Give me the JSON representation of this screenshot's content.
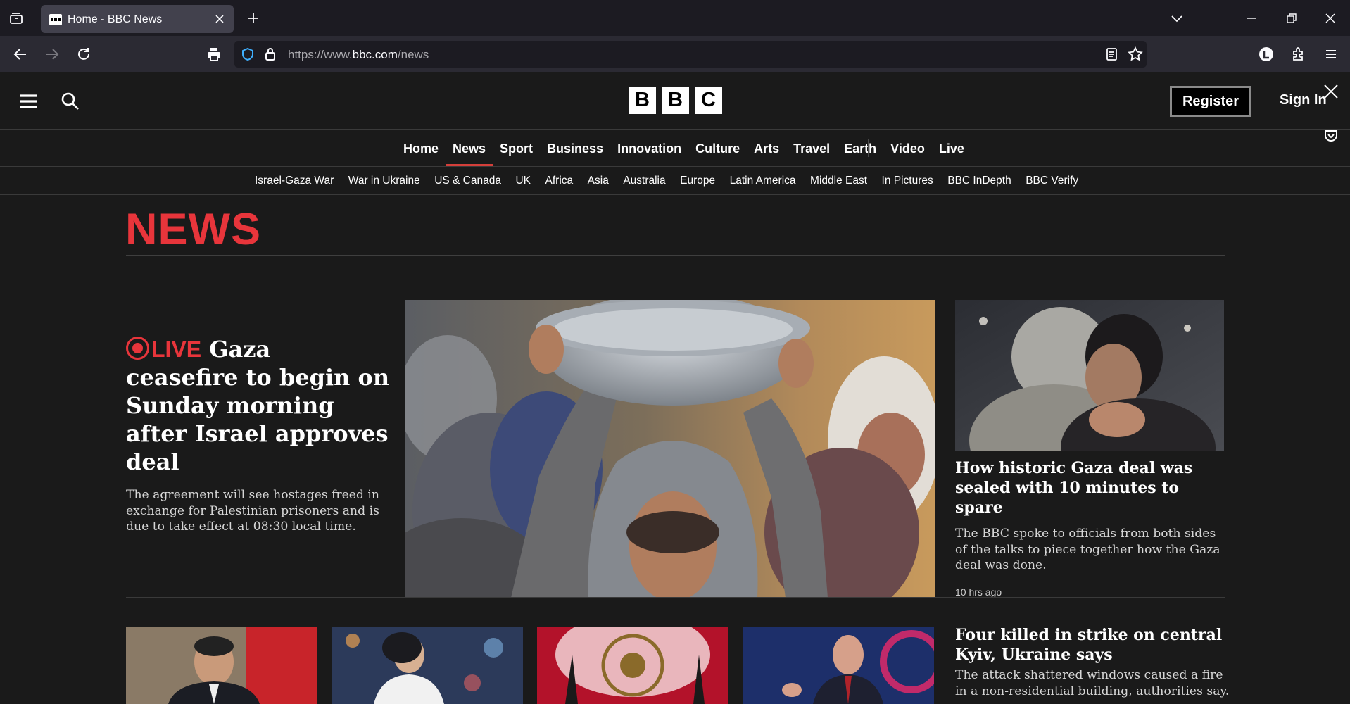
{
  "browser": {
    "tab_title": "Home - BBC News",
    "url_prefix": "https://www.",
    "url_domain": "bbc.com",
    "url_path": "/news"
  },
  "masthead": {
    "logo_letters": [
      "B",
      "B",
      "C"
    ],
    "register_label": "Register",
    "signin_label": "Sign In"
  },
  "primary_nav": [
    "Home",
    "News",
    "Sport",
    "Business",
    "Innovation",
    "Culture",
    "Arts",
    "Travel",
    "Earth",
    "Video",
    "Live"
  ],
  "primary_nav_active": "News",
  "secondary_nav": [
    "Israel-Gaza War",
    "War in Ukraine",
    "US & Canada",
    "UK",
    "Africa",
    "Asia",
    "Australia",
    "Europe",
    "Latin America",
    "Middle East",
    "In Pictures",
    "BBC InDepth",
    "BBC Verify"
  ],
  "section_title": "NEWS",
  "lead_story": {
    "live_label": "LIVE",
    "headline": "Gaza ceasefire to begin on Sunday morning after Israel approves deal",
    "summary": "The agreement will see hostages freed in exchange for Palestinian prisoners and is due to take effect at 08:30 local time."
  },
  "side_story": {
    "headline": "How historic Gaza deal was sealed with 10 minutes to spare",
    "summary": "The BBC spoke to officials from both sides of the talks to piece together how the Gaza deal was done.",
    "time": "10 hrs ago"
  },
  "story_4": {
    "headline": "Four killed in strike on central Kyiv, Ukraine says",
    "summary": "The attack shattered windows caused a fire in a non-residential building, authorities say."
  },
  "colors": {
    "accent_red": "#e8353b",
    "background": "#1a1a1a"
  }
}
